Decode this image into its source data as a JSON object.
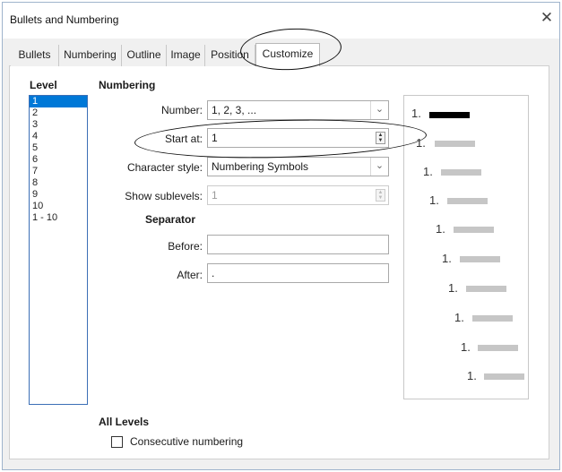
{
  "window": {
    "title": "Bullets and Numbering",
    "close_glyph": "✕"
  },
  "tabs": [
    {
      "label": "Bullets"
    },
    {
      "label": "Numbering"
    },
    {
      "label": "Outline"
    },
    {
      "label": "Image"
    },
    {
      "label": "Position"
    },
    {
      "label": "Customize",
      "active": true
    }
  ],
  "level": {
    "header": "Level",
    "items": [
      "1",
      "2",
      "3",
      "4",
      "5",
      "6",
      "7",
      "8",
      "9",
      "10",
      "1 - 10"
    ],
    "selected": "1"
  },
  "numbering": {
    "header": "Numbering",
    "number_label": "Number:",
    "number_value": "1, 2, 3, ...",
    "start_label": "Start at:",
    "start_value": "1",
    "charstyle_label": "Character style:",
    "charstyle_value": "Numbering Symbols",
    "sublevels_label": "Show sublevels:",
    "sublevels_value": "1",
    "separator_header": "Separator",
    "before_label": "Before:",
    "before_value": "",
    "after_label": "After:",
    "after_value": "."
  },
  "preview": {
    "items": [
      "1.",
      "1.",
      "1.",
      "1.",
      "1.",
      "1.",
      "1.",
      "1.",
      "1.",
      "1."
    ]
  },
  "all_levels": {
    "header": "All Levels",
    "consecutive_label": "Consecutive numbering",
    "consecutive_checked": false
  },
  "icons": {
    "close": "close-icon",
    "dropdown": "chevron-down-icon",
    "spin": "spin-arrows-icon"
  }
}
